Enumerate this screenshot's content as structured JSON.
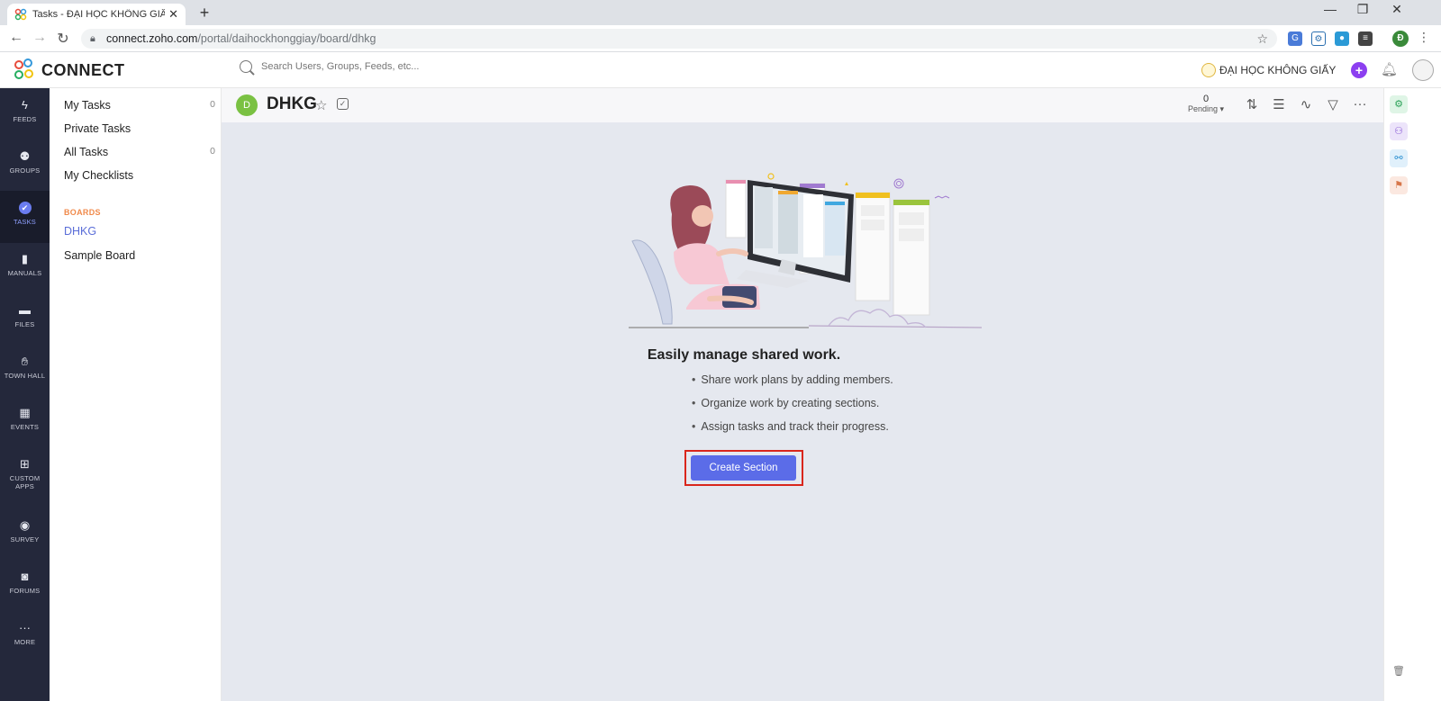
{
  "browser": {
    "tab_title": "Tasks - ĐẠI HỌC KHÔNG GIẤY -",
    "tab_close": "✕",
    "new_tab": "+",
    "win_min": "—",
    "win_max": "❐",
    "win_close": "✕",
    "url_host": "connect.zoho.com",
    "url_path": "/portal/daihockhonggiay/board/dhkg",
    "profile_initial": "Đ"
  },
  "header": {
    "brand": "CONNECT",
    "search_placeholder": "Search Users, Groups, Feeds, etc...",
    "org_name": "ĐẠI HỌC KHÔNG GIẤY"
  },
  "leftnav": {
    "items": [
      {
        "label": "FEEDS",
        "icon": "bolt-icon"
      },
      {
        "label": "GROUPS",
        "icon": "groups-icon"
      },
      {
        "label": "TASKS",
        "icon": "check-circle-icon"
      },
      {
        "label": "MANUALS",
        "icon": "book-icon"
      },
      {
        "label": "FILES",
        "icon": "folder-icon"
      },
      {
        "label": "TOWN HALL",
        "icon": "hand-icon"
      },
      {
        "label": "EVENTS",
        "icon": "calendar-icon"
      },
      {
        "label": "CUSTOM",
        "label2": "APPS",
        "icon": "apps-icon"
      },
      {
        "label": "SURVEY",
        "icon": "survey-icon"
      },
      {
        "label": "FORUMS",
        "icon": "chat-icon"
      },
      {
        "label": "MORE",
        "icon": "more-icon"
      }
    ]
  },
  "sidebar": {
    "my_tasks": "My Tasks",
    "my_tasks_count": "0",
    "private_tasks": "Private Tasks",
    "all_tasks": "All Tasks",
    "all_tasks_count": "0",
    "my_checklists": "My Checklists",
    "boards_label": "BOARDS",
    "boards": [
      "DHKG",
      "Sample Board"
    ]
  },
  "board": {
    "avatar_letter": "D",
    "title": "DHKG",
    "pending_count": "0",
    "pending_label": "Pending"
  },
  "empty_state": {
    "headline": "Easily manage shared work.",
    "bullets": [
      "Share work plans by adding members.",
      "Organize work by creating sections.",
      "Assign tasks and track their progress."
    ],
    "button": "Create Section"
  },
  "colors": {
    "accent": "#5b6ce8",
    "nav_bg": "#24283b",
    "highlight_border": "#d9261c",
    "boards_label": "#f08a4b"
  }
}
